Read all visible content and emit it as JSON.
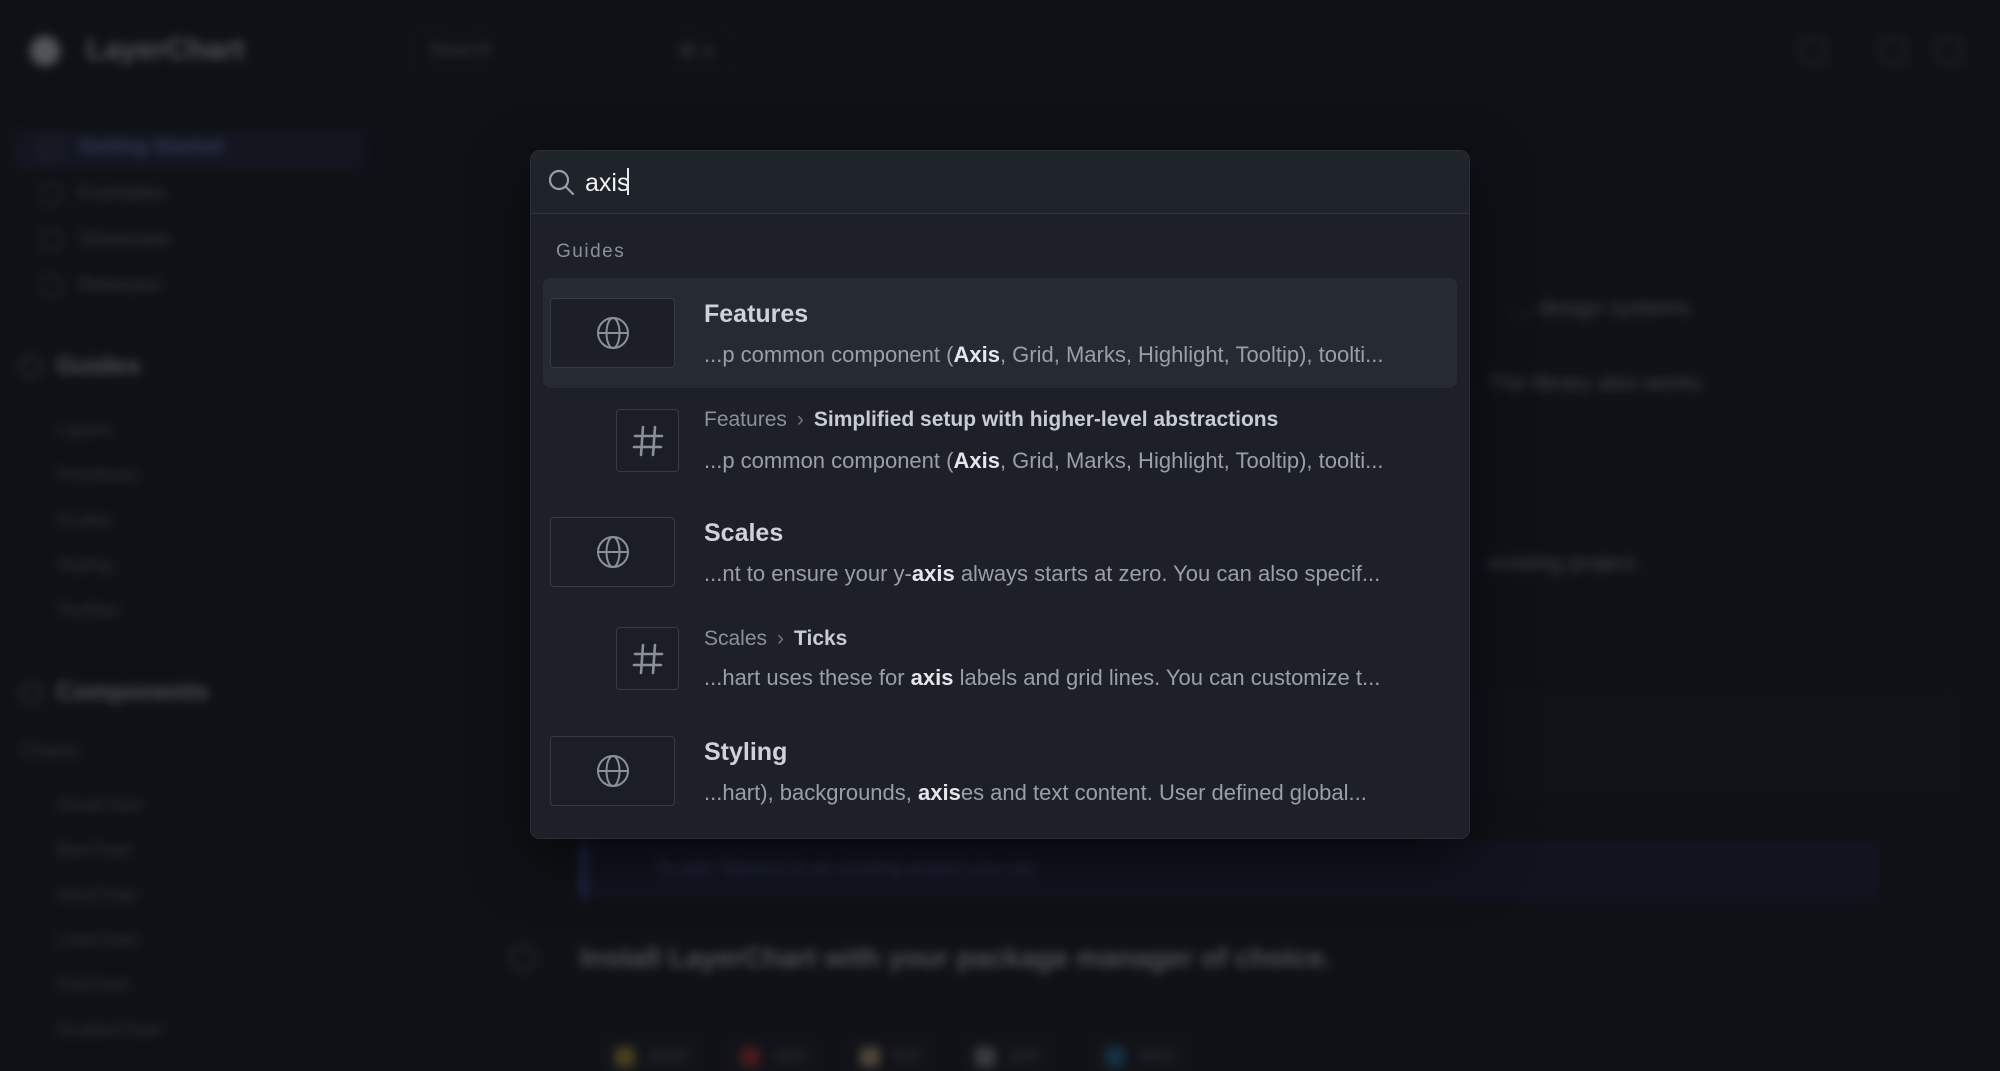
{
  "app": {
    "name": "LayerChart"
  },
  "topbar": {
    "search_label": "Search",
    "search_shortcut": "⌘ K"
  },
  "sidebar": {
    "items": [
      "Getting Started",
      "Examples",
      "Showcase",
      "Releases"
    ],
    "guides_title": "Guides",
    "guides": [
      "Layers",
      "Primitives",
      "Scales",
      "Styling",
      "Tooltips"
    ],
    "components_title": "Components",
    "charts_title": "Charts",
    "charts": [
      "AreaChart",
      "BarChart",
      "GeoChart",
      "LineChart",
      "PieChart",
      "ScatterChart"
    ]
  },
  "content": {
    "line1": "… design systems.",
    "line2": "… The library also works",
    "line3": "… existing project.",
    "note": "To add Tailwind to an existing project you can",
    "step": "Install LayerChart with your package manager of choice.",
    "chips": [
      "pnpm",
      "npm",
      "bun",
      "yarn",
      "deno"
    ]
  },
  "palette": {
    "query": "axis",
    "group": "Guides",
    "results": [
      {
        "type": "page",
        "title": "Features",
        "snippet_pre": "...p common component (",
        "snippet_match": "Axis",
        "snippet_post": ", Grid, Marks, Highlight, Tooltip), toolti..."
      },
      {
        "type": "section",
        "crumb_parent": "Features",
        "crumb_title": "Simplified setup with higher-level abstractions",
        "snippet_pre": "...p common component (",
        "snippet_match": "Axis",
        "snippet_post": ", Grid, Marks, Highlight, Tooltip), toolti..."
      },
      {
        "type": "page",
        "title": "Scales",
        "snippet_pre": "...nt to ensure your y-",
        "snippet_match": "axis",
        "snippet_post": " always starts at zero. You can also specif..."
      },
      {
        "type": "section",
        "crumb_parent": "Scales",
        "crumb_title": "Ticks",
        "snippet_pre": "...hart uses these for ",
        "snippet_match": "axis",
        "snippet_post": " labels and grid lines. You can customize t..."
      },
      {
        "type": "page",
        "title": "Styling",
        "snippet_pre": "...hart), backgrounds, ",
        "snippet_match": "axis",
        "snippet_post": "es and text content. User defined global..."
      }
    ]
  },
  "colors": {
    "accent": "#6f7bd6",
    "palette_bg": "#1d2027",
    "page_bg": "#13161b"
  }
}
